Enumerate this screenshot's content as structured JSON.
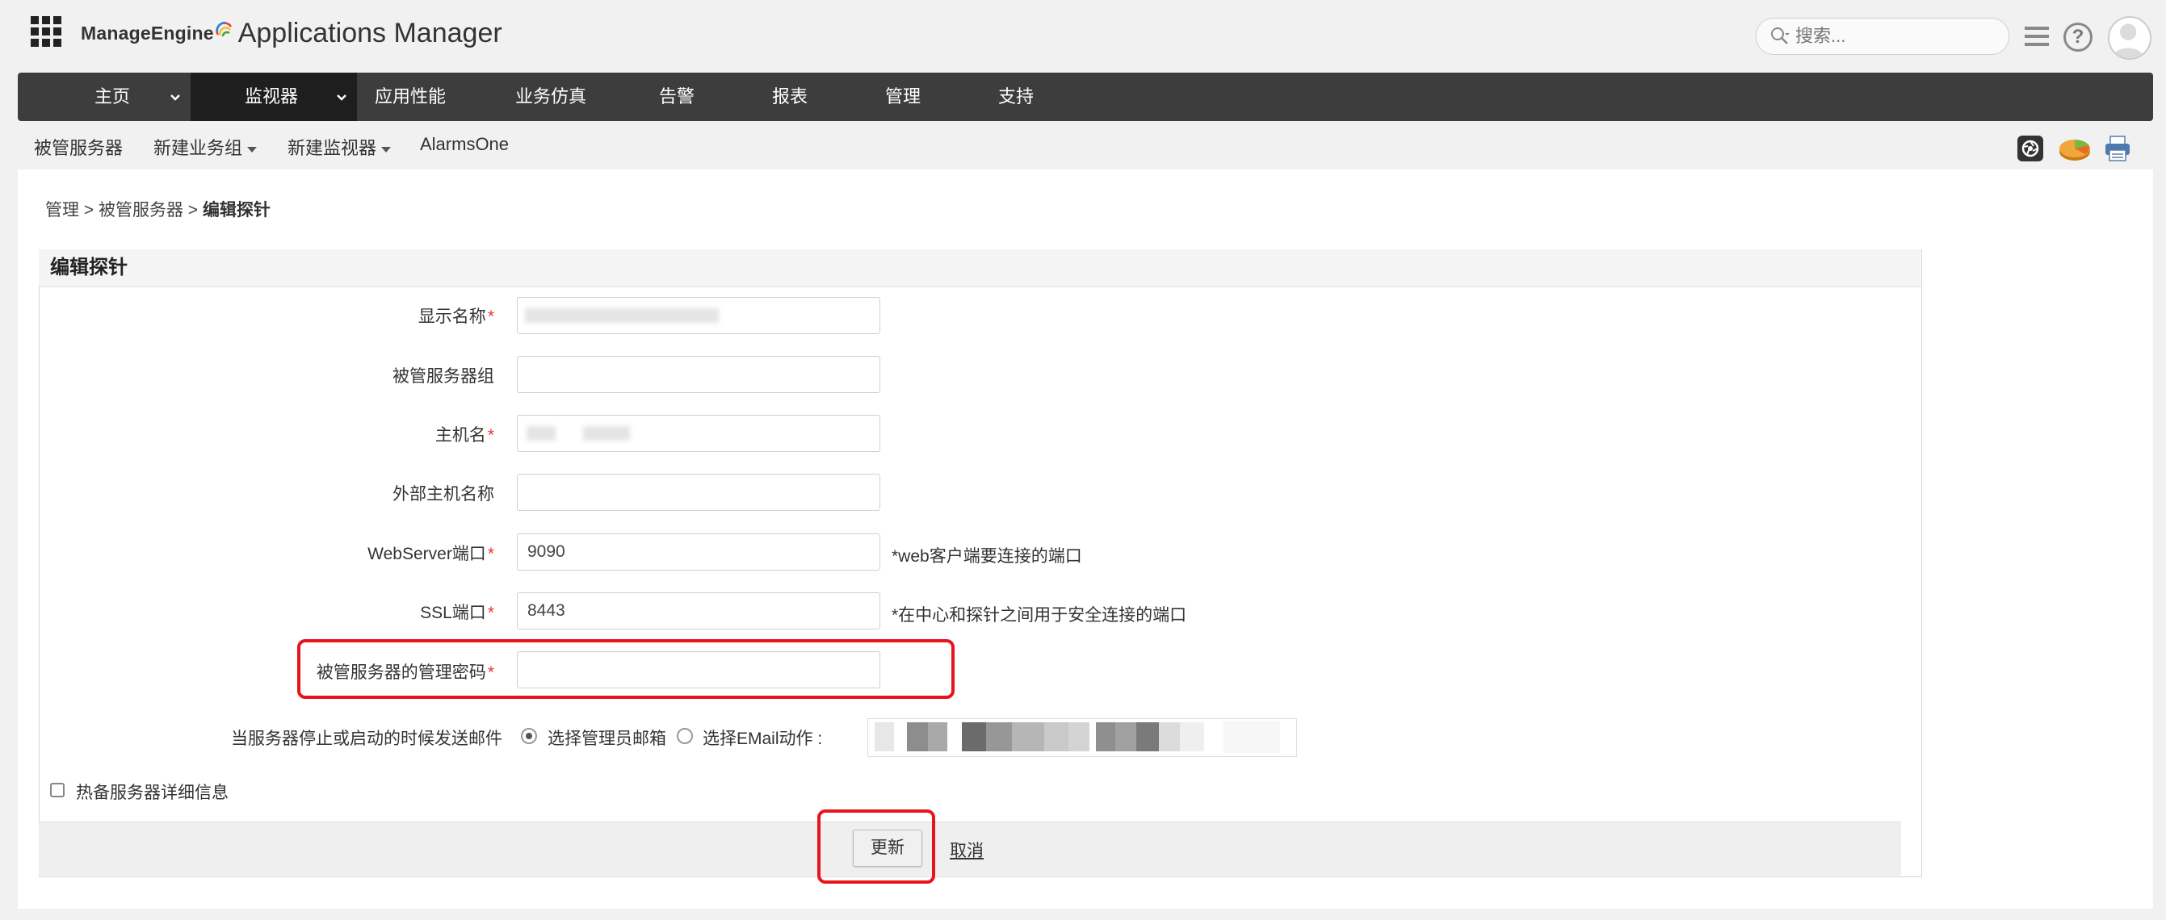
{
  "header": {
    "company": "ManageEngine",
    "product": "Applications Manager",
    "search_placeholder": "搜索...",
    "help_glyph": "?"
  },
  "main_nav": {
    "items": [
      {
        "label": "主页",
        "has_dropdown": true,
        "active": false
      },
      {
        "label": "监视器",
        "has_dropdown": true,
        "active": true
      },
      {
        "label": "应用性能",
        "has_dropdown": false,
        "active": false
      },
      {
        "label": "业务仿真",
        "has_dropdown": false,
        "active": false
      },
      {
        "label": "告警",
        "has_dropdown": false,
        "active": false
      },
      {
        "label": "报表",
        "has_dropdown": false,
        "active": false
      },
      {
        "label": "管理",
        "has_dropdown": false,
        "active": false
      },
      {
        "label": "支持",
        "has_dropdown": false,
        "active": false
      }
    ]
  },
  "sub_nav": {
    "items": [
      {
        "label": "被管服务器",
        "has_dropdown": false
      },
      {
        "label": "新建业务组",
        "has_dropdown": true
      },
      {
        "label": "新建监视器",
        "has_dropdown": true
      },
      {
        "label": "AlarmsOne",
        "has_dropdown": false
      }
    ]
  },
  "breadcrumb": {
    "items": [
      "管理",
      "被管服务器"
    ],
    "separator": ">",
    "current": "编辑探针"
  },
  "form": {
    "title": "编辑探针",
    "fields": {
      "display_name": {
        "label": "显示名称",
        "required": true,
        "value": ""
      },
      "server_group": {
        "label": "被管服务器组",
        "required": false,
        "value": ""
      },
      "hostname": {
        "label": "主机名",
        "required": true,
        "value": ""
      },
      "external_hostname": {
        "label": "外部主机名称",
        "required": false,
        "value": ""
      },
      "webserver_port": {
        "label": "WebServer端口",
        "required": true,
        "value": "9090",
        "hint": "*web客户端要连接的端口"
      },
      "ssl_port": {
        "label": "SSL端口",
        "required": true,
        "value": "8443",
        "hint": "*在中心和探针之间用于安全连接的端口"
      },
      "admin_password": {
        "label": "被管服务器的管理密码",
        "required": true,
        "value": ""
      }
    },
    "email_notify": {
      "label": "当服务器停止或启动的时候发送邮件",
      "option_admin": "选择管理员邮箱",
      "option_email_action": "选择EMail动作 :",
      "selected": "admin"
    },
    "standby_details": {
      "label": "热备服务器详细信息",
      "checked": false
    },
    "update_label": "更新",
    "cancel_label": "取消"
  },
  "colors": {
    "nav_bg": "#3d3d3d",
    "nav_active_bg": "#1e1e1e",
    "required_star": "#e33333",
    "annotation_red": "#e8141b"
  }
}
